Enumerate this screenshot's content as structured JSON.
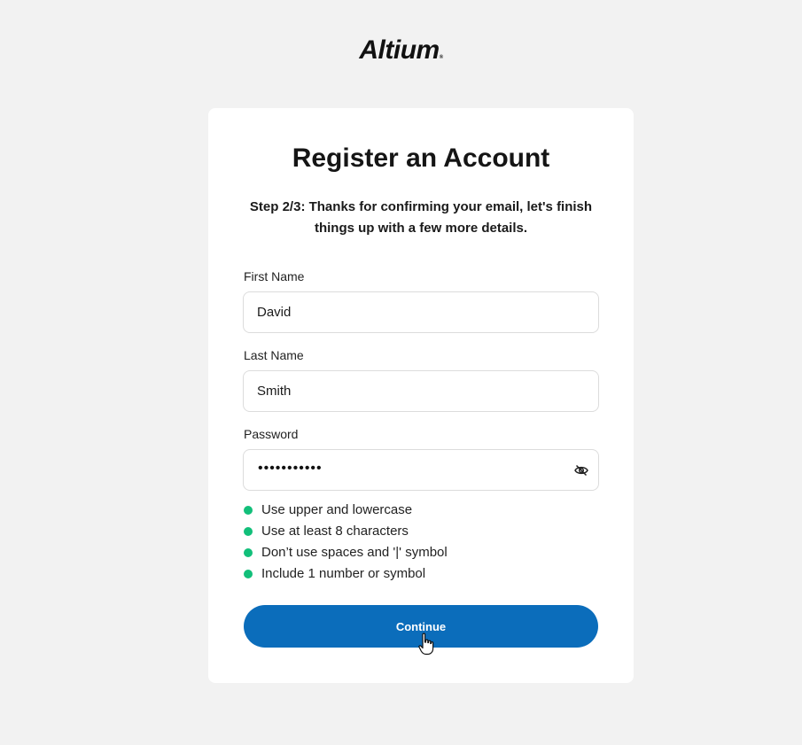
{
  "logo": {
    "text": "Altium",
    "tm": "®"
  },
  "card": {
    "title": "Register an Account",
    "subtitle": "Step 2/3: Thanks for confirming your email, let's finish things up with a few more details."
  },
  "form": {
    "first_name": {
      "label": "First Name",
      "value": "David"
    },
    "last_name": {
      "label": "Last Name",
      "value": "Smith"
    },
    "password": {
      "label": "Password",
      "masked": "•••••••••••",
      "toggle_icon": "eye-off-icon"
    }
  },
  "password_rules": [
    {
      "text": "Use upper and lowercase",
      "status": "met"
    },
    {
      "text": "Use at least 8 characters",
      "status": "met"
    },
    {
      "text": "Don’t use spaces and '|' symbol",
      "status": "met"
    },
    {
      "text": "Include 1 number or symbol",
      "status": "met"
    }
  ],
  "colors": {
    "rule_met": "#12bf7a",
    "primary_button": "#0b6dbb",
    "background": "#f2f2f2"
  },
  "actions": {
    "continue_label": "Continue"
  }
}
